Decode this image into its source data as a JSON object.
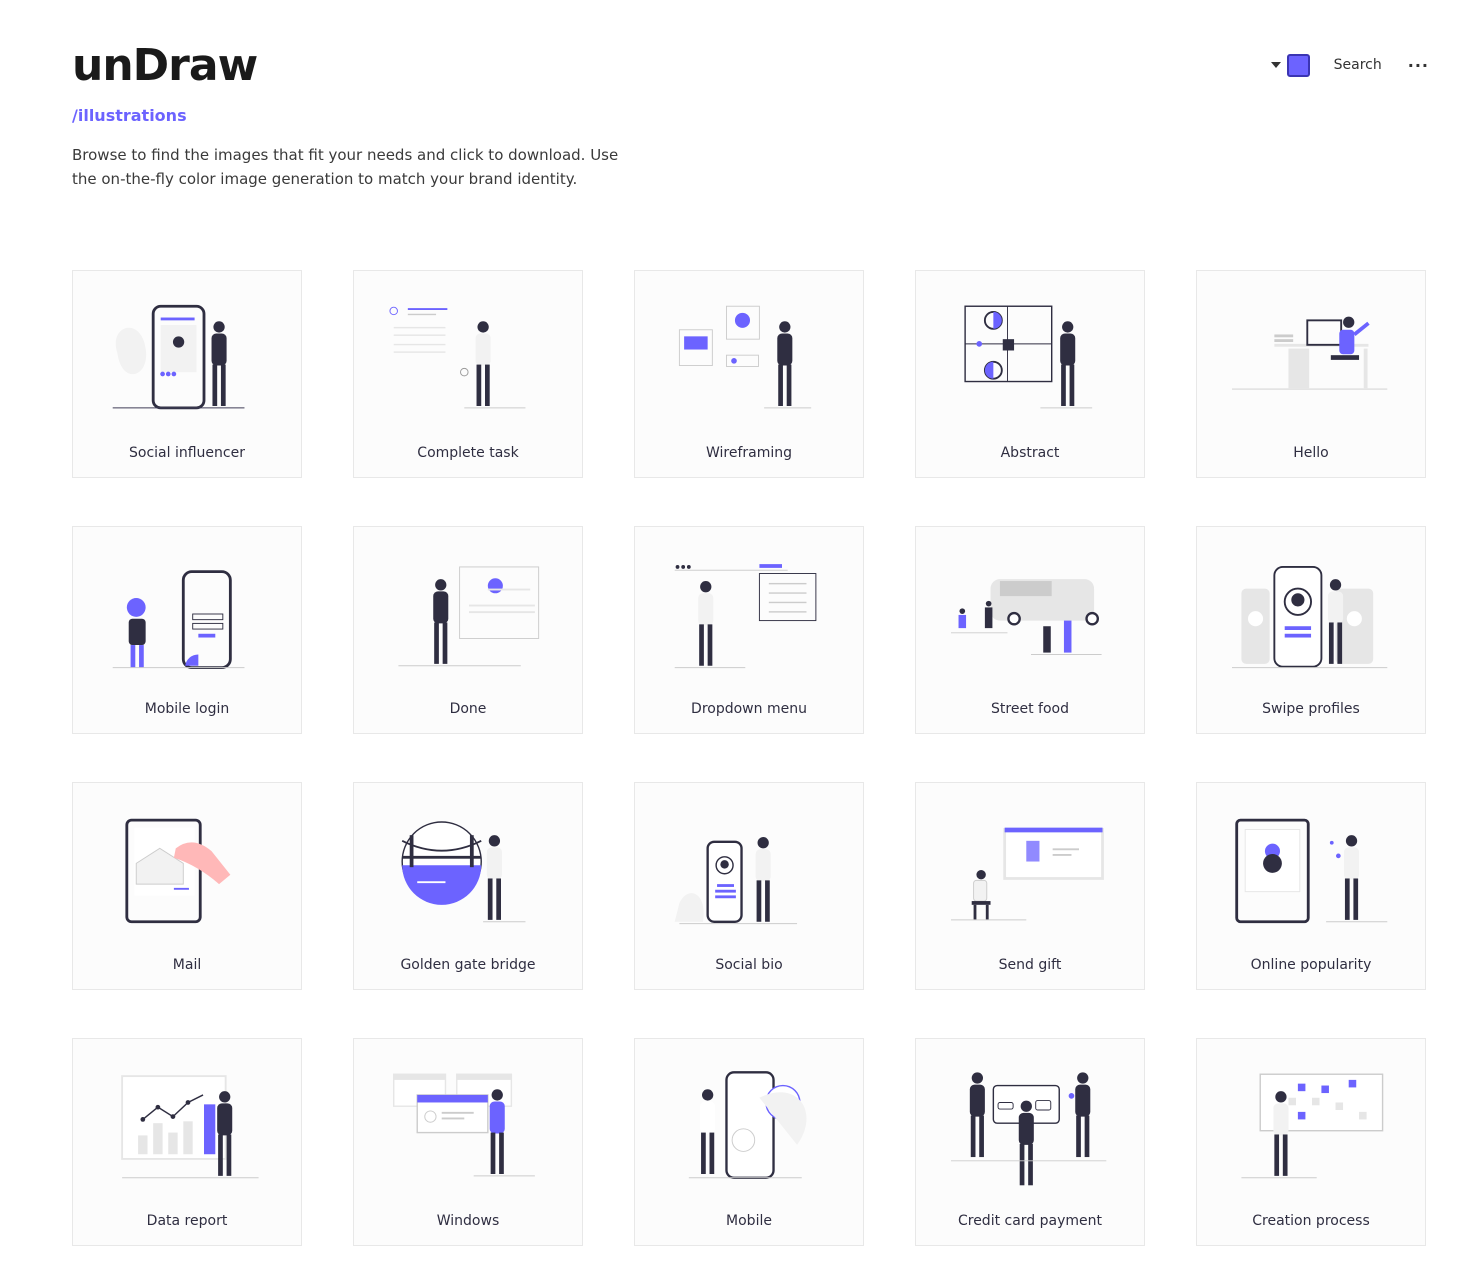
{
  "header": {
    "logo": "unDraw",
    "subtitle": "/illustrations",
    "description": "Browse to find the images that fit your needs and click to download. Use the on-the-fly color image generation to match your brand identity."
  },
  "controls": {
    "accent_color": "#6c63ff",
    "search_label": "Search",
    "more_label": "···",
    "caret_icon": "caret-down-icon"
  },
  "illustrations": [
    {
      "label": "Social influencer",
      "icon": "social-influencer-illustration"
    },
    {
      "label": "Complete task",
      "icon": "complete-task-illustration"
    },
    {
      "label": "Wireframing",
      "icon": "wireframing-illustration"
    },
    {
      "label": "Abstract",
      "icon": "abstract-illustration"
    },
    {
      "label": "Hello",
      "icon": "hello-illustration"
    },
    {
      "label": "Mobile login",
      "icon": "mobile-login-illustration"
    },
    {
      "label": "Done",
      "icon": "done-illustration"
    },
    {
      "label": "Dropdown menu",
      "icon": "dropdown-menu-illustration"
    },
    {
      "label": "Street food",
      "icon": "street-food-illustration"
    },
    {
      "label": "Swipe profiles",
      "icon": "swipe-profiles-illustration"
    },
    {
      "label": "Mail",
      "icon": "mail-illustration"
    },
    {
      "label": "Golden gate bridge",
      "icon": "golden-gate-bridge-illustration"
    },
    {
      "label": "Social bio",
      "icon": "social-bio-illustration"
    },
    {
      "label": "Send gift",
      "icon": "send-gift-illustration"
    },
    {
      "label": "Online popularity",
      "icon": "online-popularity-illustration"
    },
    {
      "label": "Data report",
      "icon": "data-report-illustration"
    },
    {
      "label": "Windows",
      "icon": "windows-illustration"
    },
    {
      "label": "Mobile",
      "icon": "mobile-illustration"
    },
    {
      "label": "Credit card payment",
      "icon": "credit-card-payment-illustration"
    },
    {
      "label": "Creation process",
      "icon": "creation-process-illustration"
    }
  ]
}
